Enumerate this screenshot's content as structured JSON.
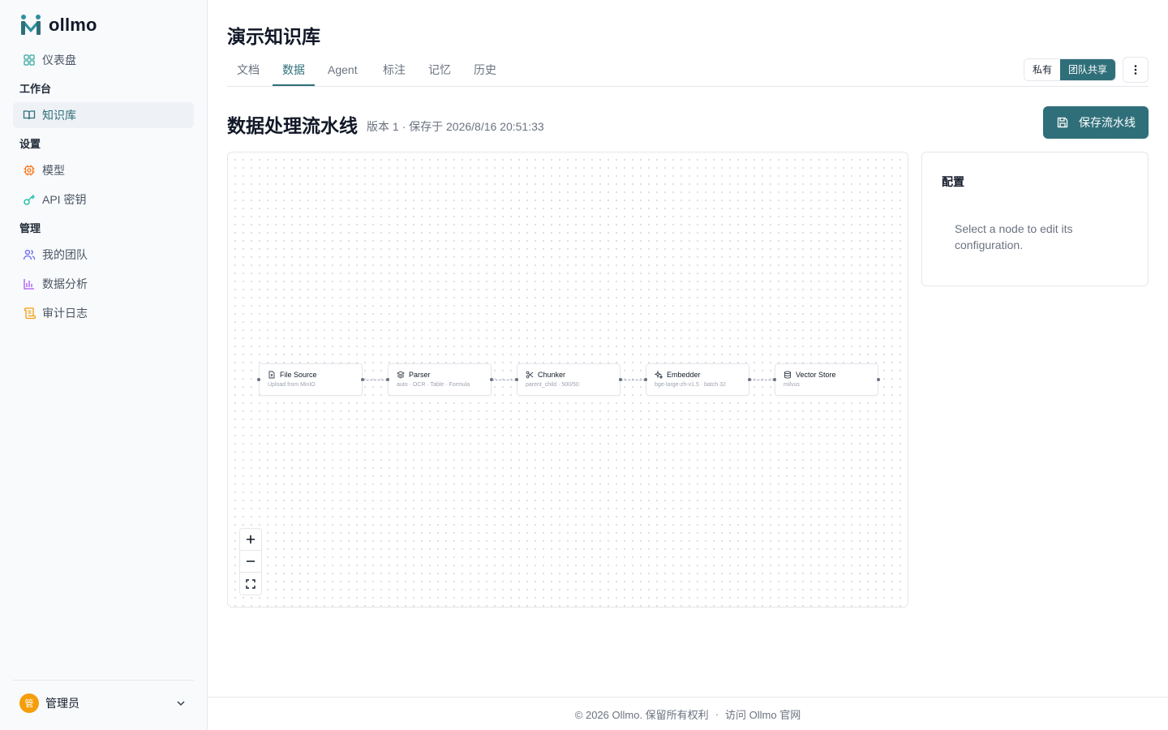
{
  "app": {
    "name": "ollmo",
    "logo_icon": "ollmo-logo-icon"
  },
  "sidebar": {
    "items": [
      {
        "label": "仪表盘",
        "icon": "dashboard-grid-icon"
      },
      {
        "section": "工作台"
      },
      {
        "label": "知识库",
        "icon": "book-open-icon",
        "active": true
      },
      {
        "section": "设置"
      },
      {
        "label": "模型",
        "icon": "cpu-chip-icon"
      },
      {
        "label": "API 密钥",
        "icon": "key-icon"
      },
      {
        "section": "管理"
      },
      {
        "label": "我的团队",
        "icon": "users-icon"
      },
      {
        "label": "数据分析",
        "icon": "bar-chart-icon"
      },
      {
        "label": "审计日志",
        "icon": "scroll-icon"
      }
    ],
    "user": {
      "avatar_text": "管",
      "name": "管理员",
      "menu_icon": "chevron-down-icon"
    }
  },
  "page": {
    "title": "演示知识库",
    "tabs": [
      "文档",
      "数据",
      "Agent",
      "标注",
      "记忆",
      "历史"
    ],
    "active_tab": "数据",
    "share": {
      "options": [
        "私有",
        "团队共享"
      ],
      "selected": "团队共享"
    },
    "more_icon": "more-vertical-icon"
  },
  "pipeline": {
    "title": "数据处理流水线",
    "meta": "版本 1 · 保存于 2026/8/16 20:51:33",
    "save_label": "保存流水线",
    "nodes": [
      {
        "name": "File Source",
        "sub": "Upload from MinIO",
        "icon": "file-upload-icon"
      },
      {
        "name": "Parser",
        "sub": "auto · OCR · Table · Formula",
        "icon": "layers-icon"
      },
      {
        "name": "Chunker",
        "sub": "parent_child · 500/50",
        "icon": "scissors-icon"
      },
      {
        "name": "Embedder",
        "sub": "bge-large-zh-v1.5 · batch 32",
        "icon": "sparkle-icon"
      },
      {
        "name": "Vector Store",
        "sub": "milvus",
        "icon": "database-icon"
      }
    ],
    "zoom_controls": [
      "+",
      "−",
      "fit"
    ]
  },
  "config": {
    "title": "配置",
    "hint": "Select a node to edit its configuration."
  },
  "footer": {
    "copyright": "© 2026 Ollmo. 保留所有权利",
    "separator": "·",
    "link": "访问 Ollmo 官网"
  },
  "colors": {
    "accent": "#2f6f7a",
    "avatar": "#f59e0b",
    "border": "#e5e7eb"
  }
}
